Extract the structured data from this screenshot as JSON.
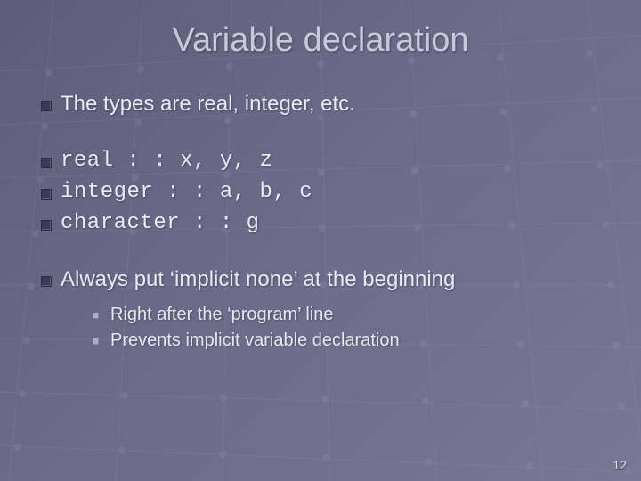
{
  "title": "Variable declaration",
  "bullets": {
    "b0": "The types are real, integer, etc.",
    "b1": "real : : x, y, z",
    "b2": "integer : : a, b, c",
    "b3": "character : : g",
    "b4": "Always put ‘implicit none’ at the beginning"
  },
  "sub": {
    "s0": "Right after the ‘program’ line",
    "s1": "Prevents implicit variable declaration"
  },
  "page_number": "12"
}
